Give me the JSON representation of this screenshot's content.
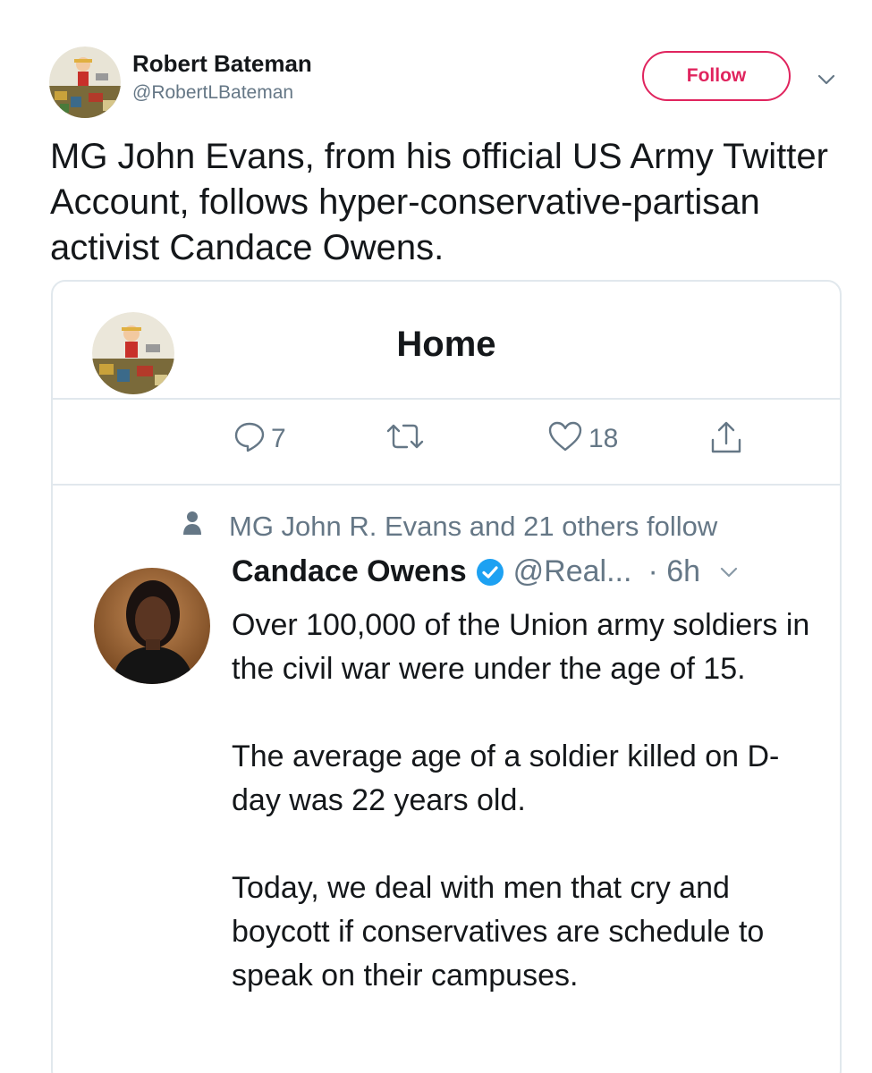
{
  "tweet": {
    "author_name": "Robert Bateman",
    "author_handle": "@RobertLBateman",
    "follow_label": "Follow",
    "text": "MG John Evans, from his official US Army Twitter Account, follows hyper-conservative-partisan activist Candace Owens."
  },
  "screenshot": {
    "title": "Home",
    "actions": {
      "reply_count": "7",
      "like_count": "18"
    },
    "social_context": "MG John R. Evans and 21 others follow",
    "inner_tweet": {
      "name": "Candace Owens",
      "handle": "@Real...",
      "time": "· 6h",
      "paragraphs": [
        "Over 100,000 of the Union army soldiers in the civil war were under the age of 15.",
        "The average age of a soldier killed on D-day was 22 years old.",
        "Today, we deal with men that cry and boycott if conservatives are schedule to speak on their campuses."
      ]
    }
  },
  "colors": {
    "follow": "#e0245e",
    "secondary_text": "#657786",
    "verified": "#1da1f2",
    "border": "#e1e8ed"
  },
  "icons": [
    "chevron-down-icon",
    "reply-icon",
    "retweet-icon",
    "like-icon",
    "share-icon",
    "person-icon",
    "verified-badge-icon"
  ]
}
